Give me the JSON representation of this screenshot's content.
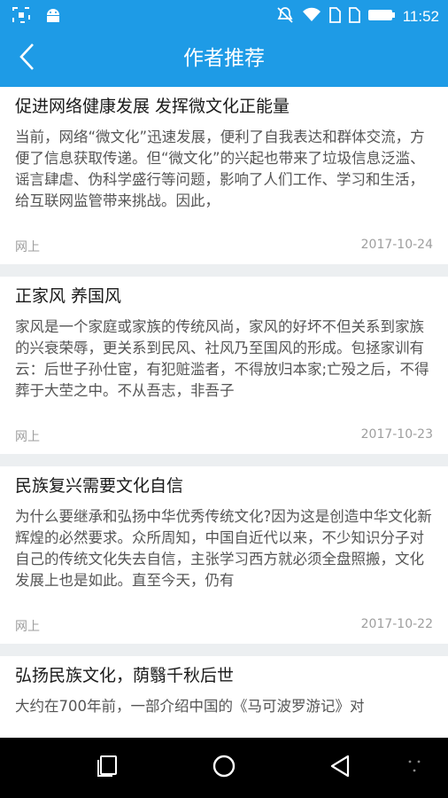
{
  "status_bar": {
    "time": "11:52",
    "icons": [
      "screenshot-icon",
      "android-icon",
      "mute-icon",
      "wifi-icon",
      "sim-icon",
      "sim-icon",
      "battery-icon"
    ]
  },
  "header": {
    "title": "作者推荐",
    "back_icon": "chevron-left-icon"
  },
  "articles": [
    {
      "title": "促进网络健康发展 发挥微文化正能量",
      "summary": "当前，网络“微文化”迅速发展，便利了自我表达和群体交流，方便了信息获取传递。但“微文化”的兴起也带来了垃圾信息泛滥、谣言肆虐、伪科学盛行等问题，影响了人们工作、学习和生活，给互联网监管带来挑战。因此，",
      "source": "网上",
      "date": "2017-10-24"
    },
    {
      "title": "正家风 养国风",
      "summary": "家风是一个家庭或家族的传统风尚，家风的好坏不但关系到家族的兴衰荣辱，更关系到民风、社风乃至国风的形成。包拯家训有云：后世子孙仕宦，有犯赃滥者，不得放归本家;亡殁之后，不得葬于大茔之中。不从吾志，非吾子",
      "source": "网上",
      "date": "2017-10-23"
    },
    {
      "title": "民族复兴需要文化自信",
      "summary": "为什么要继承和弘扬中华优秀传统文化?因为这是创造中华文化新辉煌的必然要求。众所周知，中国自近代以来，不少知识分子对自己的传统文化失去自信，主张学习西方就必须全盘照搬，文化发展上也是如此。直至今天，仍有",
      "source": "网上",
      "date": "2017-10-22"
    },
    {
      "title": "弘扬民族文化，荫翳千秋后世",
      "summary": "大约在700年前，一部介绍中国的《马可波罗游记》对"
    }
  ],
  "nav_bar": {
    "icons": [
      "recents-icon",
      "home-icon",
      "back-icon",
      "menu-dots-icon"
    ]
  }
}
